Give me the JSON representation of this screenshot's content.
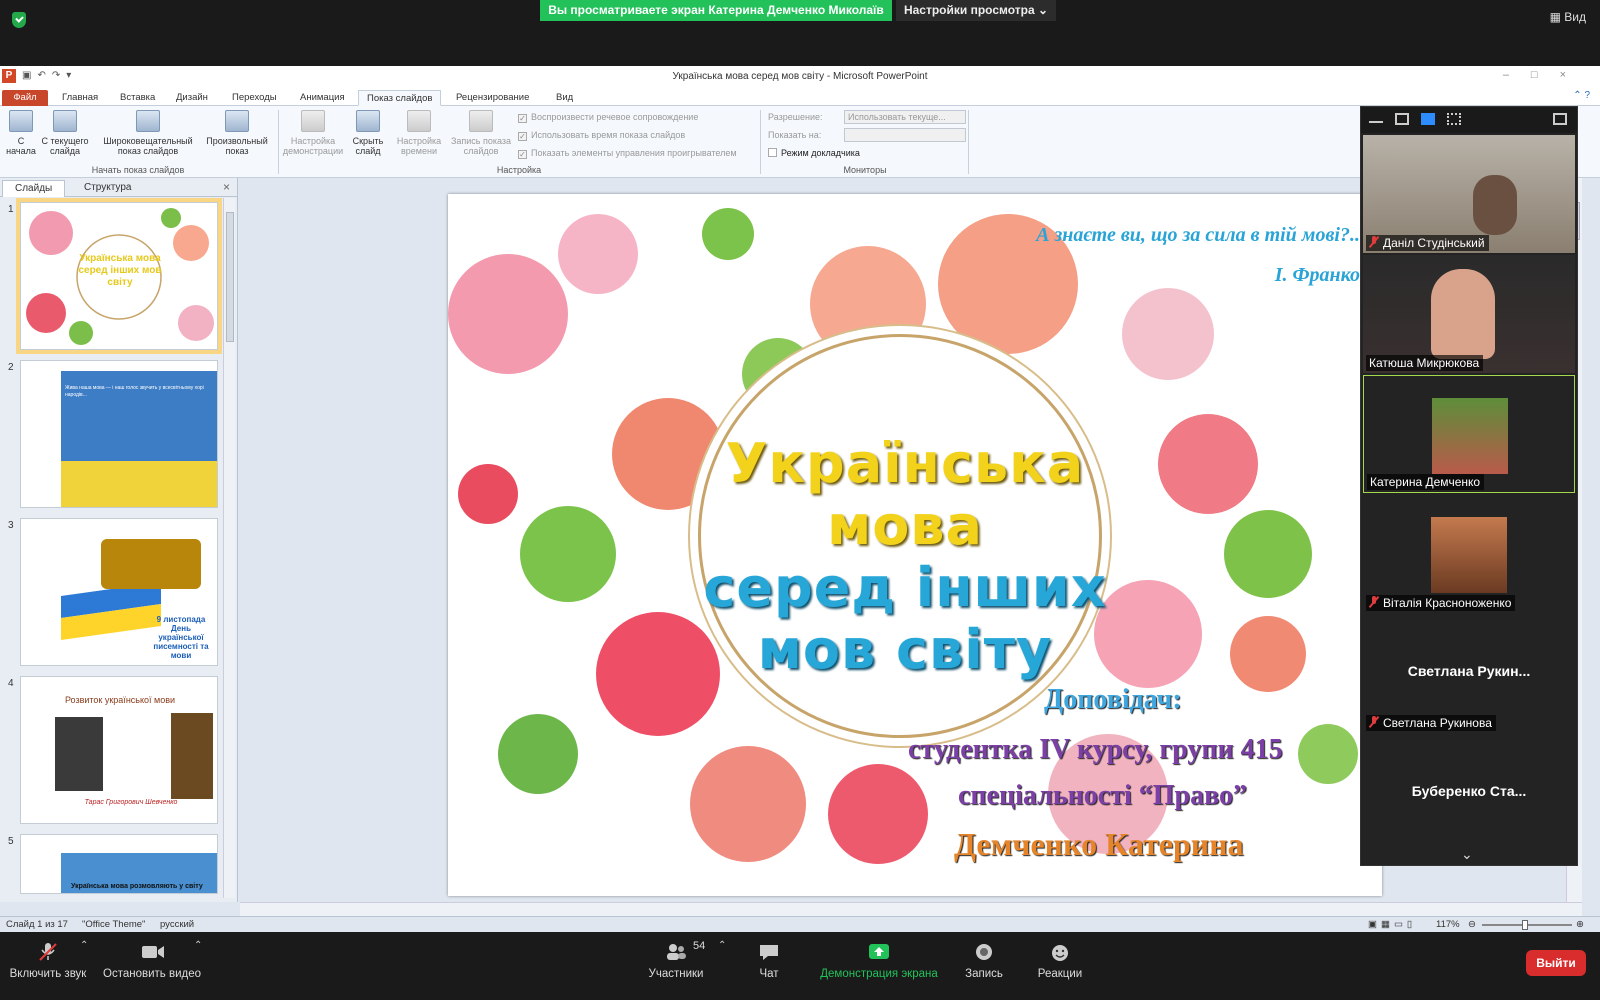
{
  "zoom": {
    "share_banner": "Вы просматриваете экран Катерина Демченко Миколаїв",
    "view_options": "Настройки просмотра",
    "view_label": "Вид",
    "bottom": {
      "mute": "Включить звук",
      "video": "Остановить видео",
      "participants": "Участники",
      "participants_count": "54",
      "chat": "Чат",
      "share": "Демонстрация экрана",
      "record": "Запись",
      "reactions": "Реакции",
      "leave": "Выйти"
    },
    "gallery": [
      {
        "name": "Даніл Студінський",
        "muted": true,
        "type": "video"
      },
      {
        "name": "Катюша Микрюкова",
        "muted": false,
        "type": "video"
      },
      {
        "name": "Катерина Демченко",
        "muted": false,
        "type": "photo",
        "active": true
      },
      {
        "name": "Віталія Красноноженко",
        "muted": true,
        "type": "photo"
      },
      {
        "name": "Светлана Рукинова",
        "muted": true,
        "type": "text",
        "display": "Светлана Рукин..."
      },
      {
        "name": "Буберенко Станислав",
        "muted": true,
        "type": "text",
        "display": "Буберенко Ста..."
      }
    ]
  },
  "ppt": {
    "window_title": "Українська мова серед мов світу - Microsoft PowerPoint",
    "tabs": [
      "Файл",
      "Главная",
      "Вставка",
      "Дизайн",
      "Переходы",
      "Анимация",
      "Показ слайдов",
      "Рецензирование",
      "Вид"
    ],
    "active_tab": "Показ слайдов",
    "ribbon": {
      "btn_from_start": "С начала",
      "btn_from_current": "С текущего слайда",
      "btn_broadcast": "Широковещательный показ слайдов",
      "btn_custom": "Произвольный показ",
      "group_start": "Начать показ слайдов",
      "btn_setup": "Настройка демонстрации",
      "btn_hide": "Скрыть слайд",
      "btn_rehearse": "Настройка времени",
      "btn_record": "Запись показа слайдов",
      "chk_narration": "Воспроизвести речевое сопровождение",
      "chk_timings": "Использовать время показа слайдов",
      "chk_controls": "Показать элементы управления проигрывателем",
      "group_setup": "Настройка",
      "resolution_label": "Разрешение:",
      "resolution_value": "Использовать текуще...",
      "show_on_label": "Показать на:",
      "presenter_view": "Режим докладчика",
      "group_monitors": "Мониторы"
    },
    "panel_tabs": [
      "Слайды",
      "Структура"
    ],
    "thumbs": [
      {
        "num": "1",
        "title": "Українська мова серед інших мов світу"
      },
      {
        "num": "2",
        "text": "Жива наша мова — і наш голос звучить у всесвітньому хорі народів..."
      },
      {
        "num": "3",
        "text": "9 листопада День української писемності та мови"
      },
      {
        "num": "4",
        "title": "Розвиток української мови",
        "caption": "Тарас Григорович Шевченко"
      },
      {
        "num": "5",
        "text": "Українська мова розмовляють у світу"
      }
    ],
    "slide": {
      "quote_pre": "А ",
      "quote_words": [
        "знаєте",
        "ви",
        "що",
        "тій мові"
      ],
      "quote": "А знаєте ви, що за сила в тій мові?..",
      "quote_author": "І. Франко",
      "title_lines": [
        "Українська",
        "мова",
        "серед  інших",
        "мов  світу"
      ],
      "speaker_label": "Доповідач:",
      "speaker_line1": "студентка IV курсу, групи 415",
      "speaker_line2": "спеціальності “Право”",
      "speaker_name": "Демченко Катерина"
    },
    "status": {
      "slide_info": "Слайд 1 из 17",
      "theme": "\"Office Theme\"",
      "language": "русский",
      "zoom": "117%"
    }
  }
}
